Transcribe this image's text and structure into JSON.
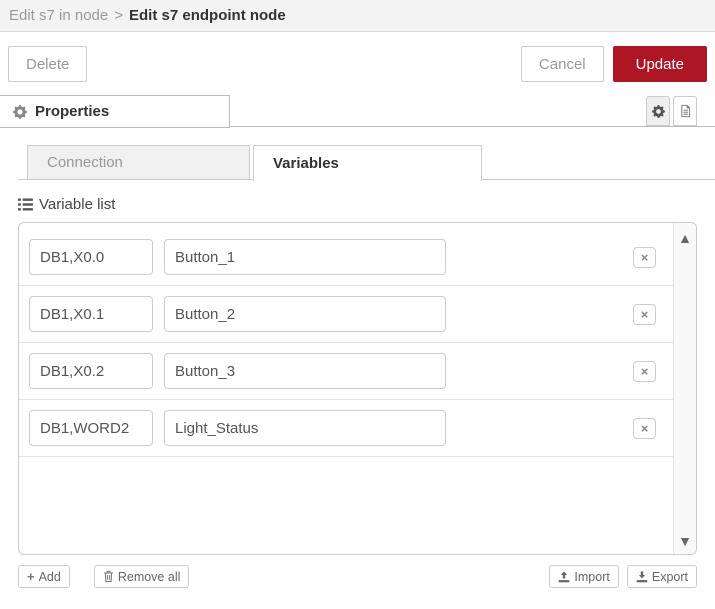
{
  "header": {
    "breadcrumb_parent": "Edit s7 in node",
    "breadcrumb_separator": ">",
    "breadcrumb_current": "Edit s7 endpoint node"
  },
  "toolbar": {
    "delete_label": "Delete",
    "cancel_label": "Cancel",
    "update_label": "Update",
    "update_color": "#AD1625"
  },
  "properties_tab": {
    "label": "Properties"
  },
  "subtabs": [
    {
      "label": "Connection",
      "active": false
    },
    {
      "label": "Variables",
      "active": true
    }
  ],
  "variable_list": {
    "title": "Variable list",
    "rows": [
      {
        "address": "DB1,X0.0",
        "name": "Button_1"
      },
      {
        "address": "DB1,X0.1",
        "name": "Button_2"
      },
      {
        "address": "DB1,X0.2",
        "name": "Button_3"
      },
      {
        "address": "DB1,WORD2",
        "name": "Light_Status"
      }
    ]
  },
  "footer": {
    "add_label": "Add",
    "remove_all_label": "Remove all",
    "import_label": "Import",
    "export_label": "Export"
  },
  "icons": {
    "properties_tab": "gear",
    "settings_button": "gear",
    "docs_button": "document",
    "variable_list": "list",
    "delete_row": "×",
    "add_symbol": "+",
    "remove_all": "trash",
    "import": "upload",
    "export": "download",
    "scroll_up": "▲",
    "scroll_down": "▼"
  }
}
